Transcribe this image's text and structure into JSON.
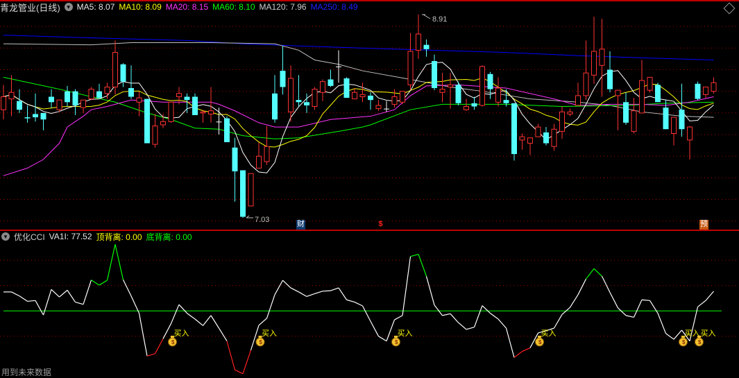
{
  "main_header": {
    "title": "青龙管业(日线)",
    "ma5": "MA5: 8.07",
    "ma10": "MA10: 8.09",
    "ma20": "MA20: 8.15",
    "ma60": "MA60: 8.10",
    "ma120": "MA120: 7.96",
    "ma250": "MA250: 8.49"
  },
  "cci_header": {
    "title": "优化CCI",
    "va1i": "VA1I: 77.52",
    "top_divergence": "顶背离: 0.00",
    "bottom_divergence": "底背离: 0.00"
  },
  "markers": {
    "finance": "财",
    "dollar": "$",
    "forecast": "预"
  },
  "footer_note": "用到未来数据",
  "colors": {
    "up": "#ff3232",
    "down": "#54ffff",
    "ma5": "#ffffff",
    "ma10": "#ffff00",
    "ma20": "#ff33ff",
    "ma60": "#00ff00",
    "ma120": "#c0c0c0",
    "ma250": "#0000ff",
    "grid": "#b00000",
    "zero_line": "#00ff00"
  },
  "chart_data": [
    {
      "type": "candlestick",
      "title": "青龙管业(日线)",
      "ylim": [
        7.03,
        8.91
      ],
      "high_label": "8.91",
      "low_label": "7.03",
      "candles_ohlc": [
        [
          8.03,
          8.26,
          7.94,
          8.15
        ],
        [
          8.13,
          8.35,
          7.97,
          8.19
        ],
        [
          8.11,
          8.22,
          8.0,
          8.03
        ],
        [
          7.96,
          8.07,
          7.91,
          7.95
        ],
        [
          7.99,
          8.18,
          7.92,
          7.96
        ],
        [
          8.0,
          8.0,
          7.84,
          7.94
        ],
        [
          8.15,
          8.22,
          8.05,
          8.1
        ],
        [
          8.03,
          8.12,
          8.01,
          8.12
        ],
        [
          8.2,
          8.25,
          8.06,
          8.1
        ],
        [
          8.2,
          8.22,
          7.98,
          8.07
        ],
        [
          8.05,
          8.12,
          8.0,
          8.12
        ],
        [
          8.13,
          8.24,
          8.12,
          8.22
        ],
        [
          8.2,
          8.27,
          8.13,
          8.14
        ],
        [
          8.18,
          8.28,
          8.13,
          8.24
        ],
        [
          8.24,
          8.67,
          8.17,
          8.56
        ],
        [
          8.45,
          8.46,
          8.24,
          8.29
        ],
        [
          8.23,
          8.44,
          8.13,
          8.15
        ],
        [
          8.1,
          8.2,
          7.97,
          8.14
        ],
        [
          8.13,
          8.13,
          7.72,
          7.72
        ],
        [
          7.71,
          7.99,
          7.68,
          7.88
        ],
        [
          7.89,
          7.99,
          7.86,
          7.92
        ],
        [
          7.92,
          8.1,
          7.91,
          8.1
        ],
        [
          8.15,
          8.24,
          8.08,
          8.18
        ],
        [
          8.15,
          8.18,
          8.0,
          8.12
        ],
        [
          8.15,
          8.18,
          7.98,
          7.98
        ],
        [
          8.0,
          8.03,
          7.91,
          8.01
        ],
        [
          7.99,
          8.24,
          7.91,
          8.02
        ],
        [
          7.92,
          8.05,
          7.8,
          7.92
        ],
        [
          7.95,
          7.97,
          7.73,
          7.73
        ],
        [
          7.68,
          7.77,
          7.18,
          7.46
        ],
        [
          7.47,
          7.47,
          7.03,
          7.04
        ],
        [
          7.14,
          7.44,
          7.14,
          7.44
        ],
        [
          7.49,
          7.73,
          7.49,
          7.6
        ],
        [
          7.55,
          7.88,
          7.52,
          7.69
        ],
        [
          8.18,
          8.35,
          7.91,
          7.94
        ],
        [
          8.39,
          8.62,
          8.17,
          8.24
        ],
        [
          8.01,
          8.44,
          7.92,
          8.32
        ],
        [
          8.12,
          8.35,
          8.06,
          8.1
        ],
        [
          8.1,
          8.18,
          8.0,
          8.07
        ],
        [
          8.06,
          8.24,
          8.03,
          8.22
        ],
        [
          8.19,
          8.31,
          8.11,
          8.29
        ],
        [
          8.31,
          8.4,
          8.24,
          8.25
        ],
        [
          8.43,
          8.58,
          8.28,
          8.43
        ],
        [
          8.32,
          8.33,
          8.14,
          8.14
        ],
        [
          8.13,
          8.23,
          8.13,
          8.19
        ],
        [
          8.15,
          8.28,
          8.1,
          8.17
        ],
        [
          8.16,
          8.19,
          8.03,
          8.12
        ],
        [
          8.04,
          8.12,
          8.02,
          8.07
        ],
        [
          8.04,
          8.11,
          8.01,
          8.04
        ],
        [
          8.08,
          8.22,
          8.05,
          8.15
        ],
        [
          8.1,
          8.2,
          8.08,
          8.2
        ],
        [
          8.26,
          8.74,
          8.21,
          8.57
        ],
        [
          8.58,
          8.91,
          8.5,
          8.73
        ],
        [
          8.63,
          8.68,
          8.52,
          8.59
        ],
        [
          8.48,
          8.54,
          8.21,
          8.23
        ],
        [
          8.19,
          8.37,
          8.1,
          8.22
        ],
        [
          8.24,
          8.37,
          8.04,
          8.26
        ],
        [
          8.26,
          8.29,
          8.07,
          8.09
        ],
        [
          8.03,
          8.13,
          8.02,
          8.06
        ],
        [
          8.09,
          8.15,
          8.03,
          8.06
        ],
        [
          8.07,
          8.44,
          8.06,
          8.43
        ],
        [
          8.36,
          8.38,
          8.13,
          8.22
        ],
        [
          8.1,
          8.33,
          8.06,
          8.23
        ],
        [
          8.12,
          8.22,
          8.06,
          8.09
        ],
        [
          8.09,
          8.09,
          7.56,
          7.62
        ],
        [
          7.75,
          7.81,
          7.66,
          7.78
        ],
        [
          7.72,
          7.77,
          7.61,
          7.77
        ],
        [
          7.78,
          7.9,
          7.78,
          7.87
        ],
        [
          7.82,
          7.87,
          7.7,
          7.72
        ],
        [
          7.69,
          7.9,
          7.65,
          7.85
        ],
        [
          7.83,
          8.06,
          7.76,
          8.01
        ],
        [
          7.99,
          8.04,
          7.97,
          8.01
        ],
        [
          8.07,
          8.28,
          8.07,
          8.16
        ],
        [
          8.16,
          8.67,
          8.12,
          8.37
        ],
        [
          8.35,
          8.89,
          8.27,
          8.57
        ],
        [
          8.44,
          8.87,
          8.15,
          8.59
        ],
        [
          8.4,
          8.57,
          8.19,
          8.22
        ],
        [
          8.16,
          8.21,
          7.84,
          8.21
        ],
        [
          8.1,
          8.19,
          7.89,
          7.91
        ],
        [
          7.83,
          8.14,
          7.81,
          8.02
        ],
        [
          8.0,
          8.49,
          8.0,
          8.3
        ],
        [
          8.21,
          8.33,
          8.19,
          8.33
        ],
        [
          8.26,
          8.28,
          8.1,
          8.1
        ],
        [
          8.05,
          8.12,
          7.85,
          7.85
        ],
        [
          7.81,
          7.96,
          7.7,
          7.96
        ],
        [
          8.03,
          8.27,
          7.78,
          7.85
        ],
        [
          7.75,
          7.88,
          7.57,
          7.87
        ],
        [
          8.27,
          8.29,
          8.12,
          8.13
        ],
        [
          8.17,
          8.24,
          8.14,
          8.24
        ],
        [
          8.2,
          8.33,
          8.18,
          8.28
        ]
      ],
      "ma_lines_index_price": {
        "MA20": [
          [
            0,
            7.42
          ],
          [
            3,
            7.49
          ],
          [
            5,
            7.57
          ],
          [
            7,
            7.72
          ],
          [
            8,
            7.87
          ],
          [
            10,
            7.97
          ],
          [
            11,
            8.03
          ],
          [
            13,
            8.06
          ],
          [
            15,
            8.1
          ],
          [
            16,
            8.12
          ],
          [
            20,
            8.1
          ],
          [
            26,
            8.1
          ],
          [
            27,
            8.08
          ],
          [
            29,
            8.02
          ],
          [
            32,
            7.91
          ],
          [
            34,
            7.87
          ],
          [
            37,
            7.87
          ],
          [
            41,
            7.94
          ],
          [
            46,
            7.97
          ],
          [
            49,
            8.03
          ],
          [
            51,
            8.16
          ],
          [
            53,
            8.25
          ],
          [
            57,
            8.26
          ],
          [
            63,
            8.23
          ],
          [
            69,
            8.13
          ],
          [
            72,
            8.07
          ],
          [
            76,
            8.08
          ],
          [
            80,
            8.08
          ],
          [
            83,
            8.07
          ],
          [
            86,
            8.1
          ],
          [
            89,
            8.15
          ]
        ],
        "MA60": [
          [
            0,
            8.33
          ],
          [
            7,
            8.22
          ],
          [
            11,
            8.15
          ],
          [
            14,
            8.1
          ],
          [
            18,
            8.0
          ],
          [
            21,
            7.94
          ],
          [
            24,
            7.86
          ],
          [
            27,
            7.85
          ],
          [
            30,
            7.79
          ],
          [
            34,
            7.76
          ],
          [
            37,
            7.77
          ],
          [
            42,
            7.83
          ],
          [
            45,
            7.87
          ],
          [
            46,
            7.89
          ],
          [
            51,
            8.03
          ],
          [
            55,
            8.08
          ],
          [
            63,
            8.08
          ],
          [
            70,
            8.06
          ],
          [
            78,
            8.07
          ],
          [
            83,
            8.09
          ],
          [
            89,
            8.1
          ]
        ],
        "MA120": [
          [
            0,
            8.64
          ],
          [
            11,
            8.63
          ],
          [
            16,
            8.65
          ],
          [
            26,
            8.65
          ],
          [
            34,
            8.64
          ],
          [
            37,
            8.58
          ],
          [
            39,
            8.49
          ],
          [
            42,
            8.45
          ],
          [
            45,
            8.39
          ],
          [
            51,
            8.31
          ],
          [
            56,
            8.24
          ],
          [
            60,
            8.2
          ],
          [
            66,
            8.13
          ],
          [
            72,
            8.1
          ],
          [
            76,
            8.07
          ],
          [
            80,
            8.01
          ],
          [
            85,
            7.97
          ],
          [
            89,
            7.96
          ]
        ],
        "MA250": [
          [
            0,
            8.72
          ],
          [
            13,
            8.69
          ],
          [
            23,
            8.67
          ],
          [
            30,
            8.64
          ],
          [
            37,
            8.62
          ],
          [
            45,
            8.6
          ],
          [
            54,
            8.58
          ],
          [
            63,
            8.56
          ],
          [
            72,
            8.53
          ],
          [
            80,
            8.51
          ],
          [
            89,
            8.49
          ]
        ]
      },
      "ma_computed_from_closes": [
        5,
        10
      ]
    },
    {
      "type": "line",
      "title": "优化CCI",
      "reference_levels": [
        200,
        100,
        0,
        -100
      ],
      "values": [
        75,
        75,
        59,
        38,
        41,
        -16,
        85,
        55,
        82,
        35,
        26,
        122,
        102,
        121,
        263,
        123,
        59,
        -9,
        -178,
        -169,
        -110,
        -50,
        25,
        -9,
        -32,
        -58,
        -18,
        -68,
        -119,
        -233,
        -248,
        -155,
        -57,
        -29,
        64,
        121,
        91,
        75,
        57,
        68,
        78,
        80,
        91,
        44,
        35,
        20,
        -41,
        -100,
        -119,
        -35,
        -18,
        215,
        224,
        137,
        23,
        -18,
        -11,
        -46,
        -73,
        -64,
        21,
        -9,
        -32,
        -68,
        -184,
        -160,
        -146,
        -87,
        -78,
        -68,
        -14,
        14,
        64,
        126,
        167,
        137,
        73,
        12,
        -18,
        -25,
        44,
        41,
        -9,
        -89,
        -112,
        -76,
        -119,
        16,
        41,
        77.52
      ],
      "buy_signal_indices": [
        21,
        32,
        49,
        67,
        85,
        87
      ],
      "buy_label": "买入"
    }
  ]
}
